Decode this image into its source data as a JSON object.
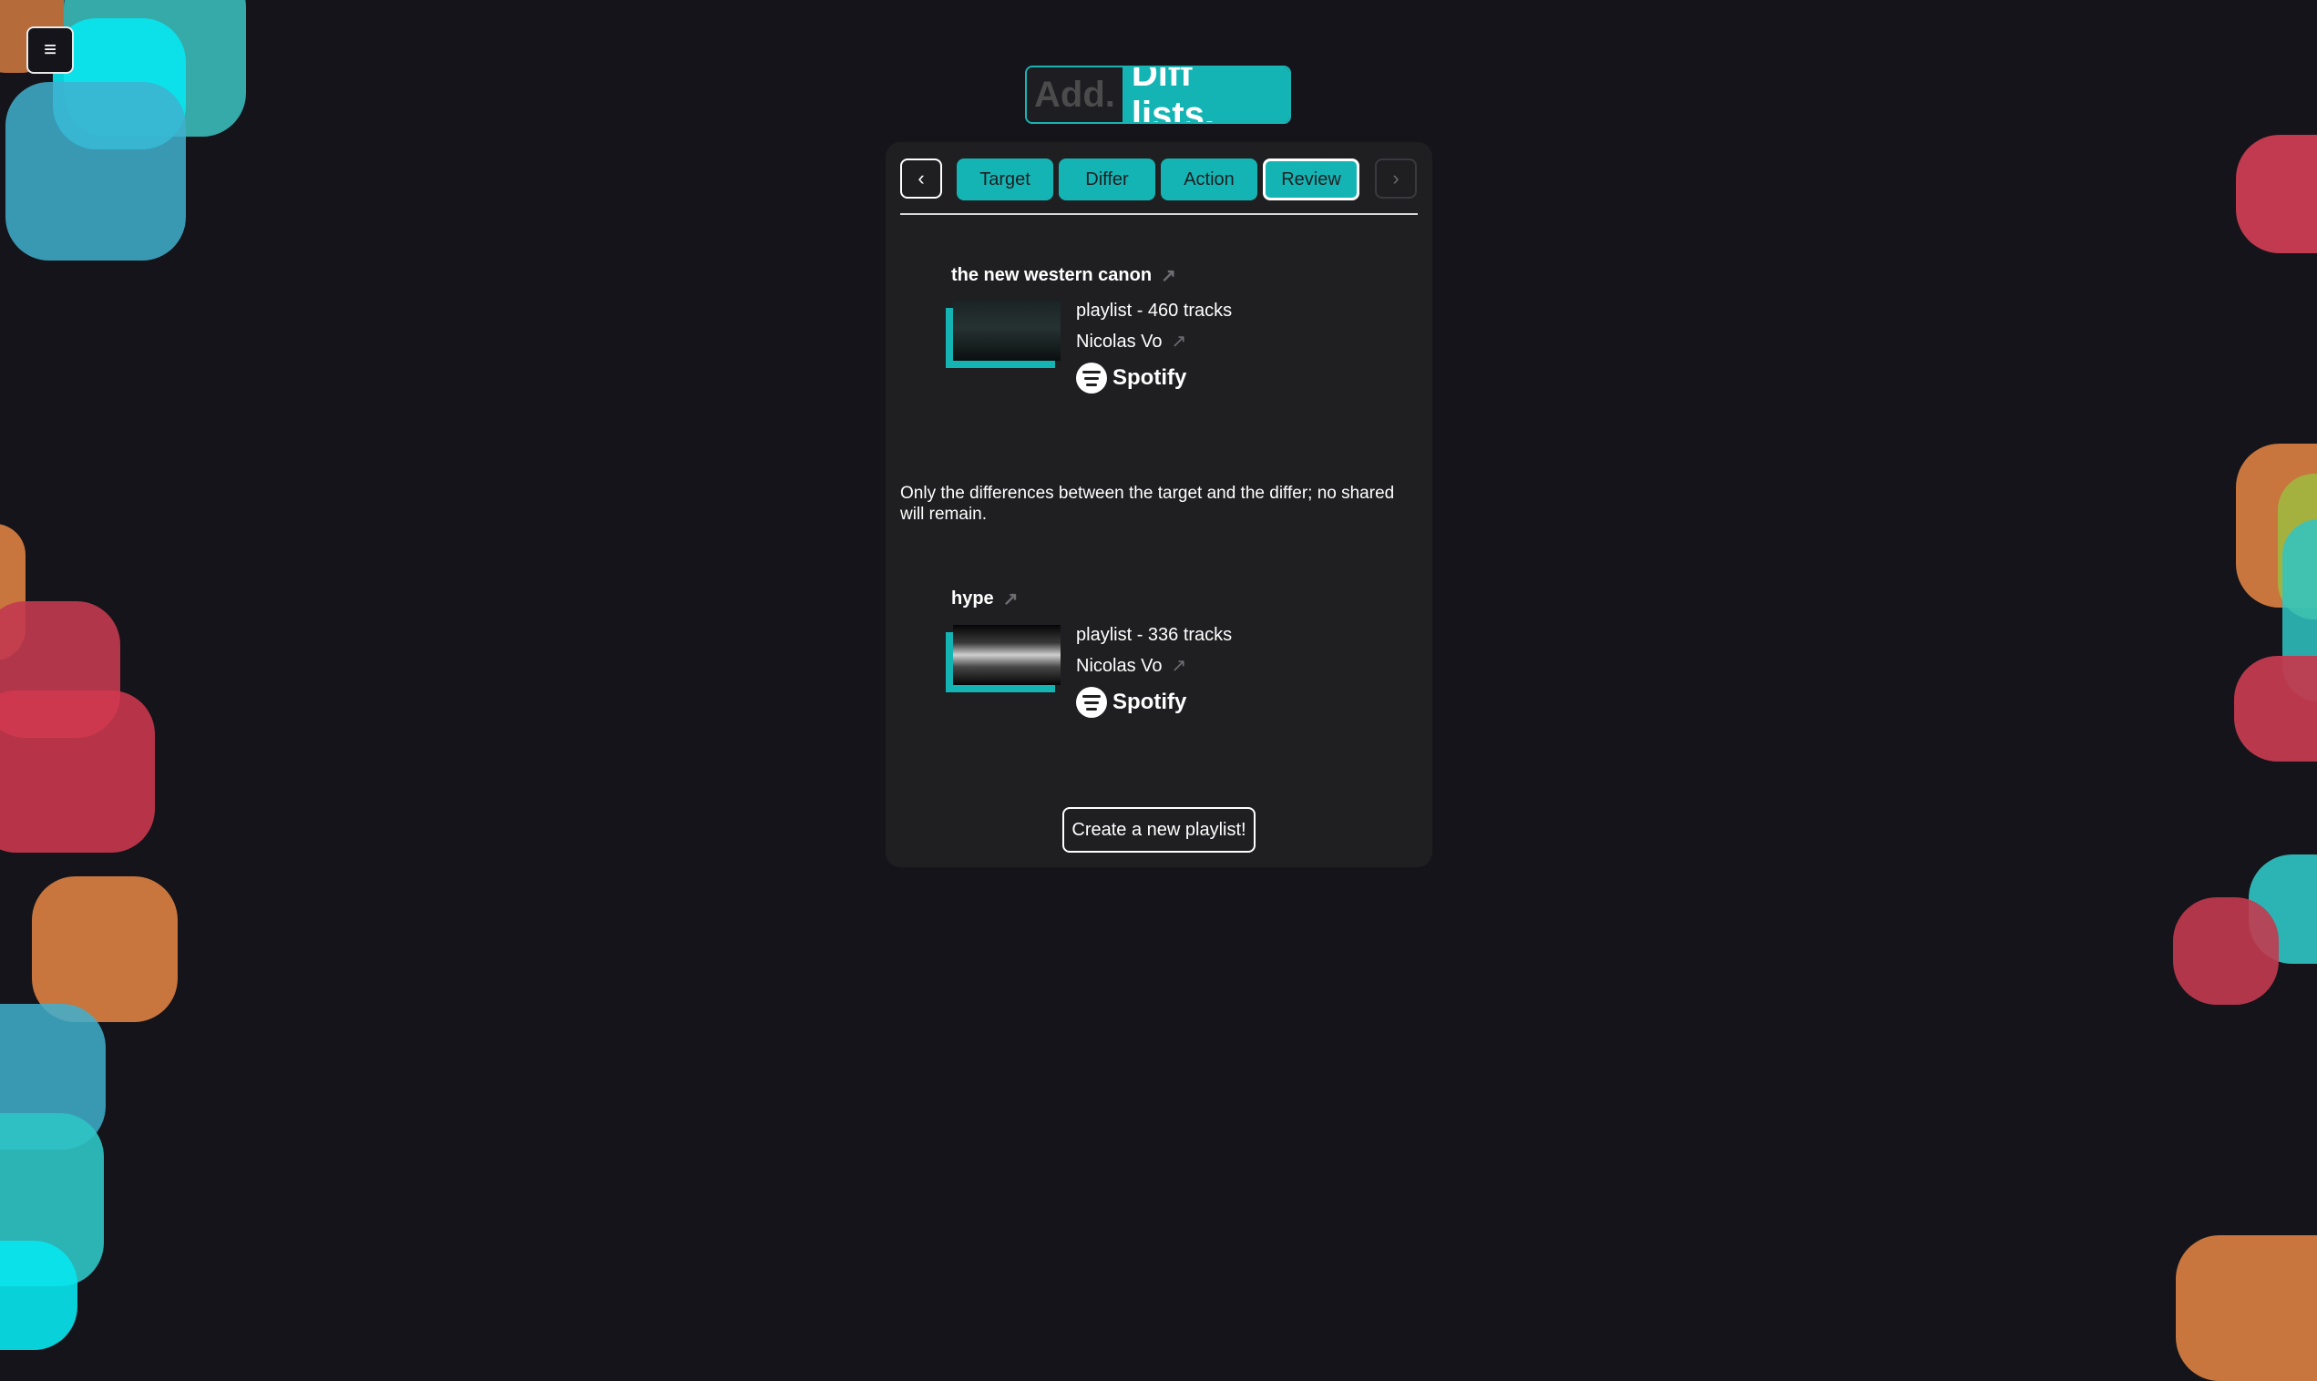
{
  "menu": {
    "icon": "menu-icon",
    "glyph": "≡"
  },
  "logo": {
    "part1": "Add.",
    "part2": "Diff lists."
  },
  "stepper": {
    "prev_icon": "chevron-left-icon",
    "prev_glyph": "‹",
    "next_icon": "chevron-right-icon",
    "next_glyph": "›",
    "tabs": [
      {
        "label": "Target"
      },
      {
        "label": "Differ"
      },
      {
        "label": "Action"
      },
      {
        "label": "Review",
        "active": true
      }
    ]
  },
  "target": {
    "title": "the new western canon",
    "link_icon": "external-link-icon",
    "type_line": "playlist - 460 tracks",
    "owner": "Nicolas Vo",
    "service": "Spotify"
  },
  "description": "Only the differences between the target and the differ; no shared will remain.",
  "differ": {
    "title": "hype",
    "link_icon": "external-link-icon",
    "type_line": "playlist - 336 tracks",
    "owner": "Nicolas Vo",
    "service": "Spotify"
  },
  "create_button": "Create a new playlist!",
  "colors": {
    "accent": "#15b4b4",
    "background": "#14141a",
    "panel": "#1f1f22",
    "red": "#c23a4f",
    "orange": "#c8763e",
    "teal": "#2fc4c4"
  }
}
